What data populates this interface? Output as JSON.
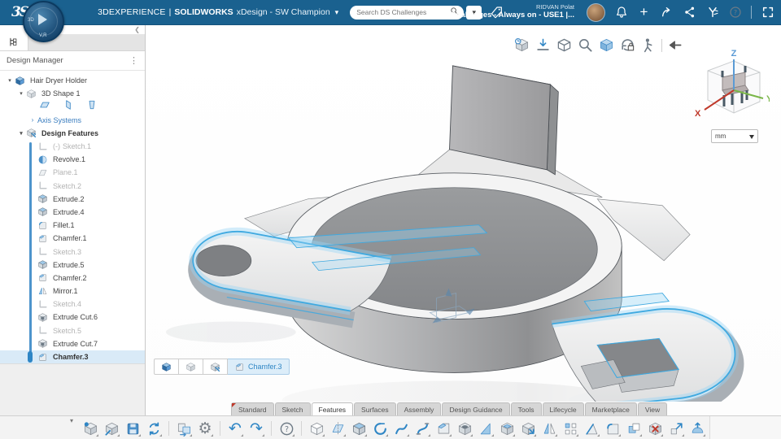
{
  "colors": {
    "topbar_bg": "#1a618f",
    "accent_blue": "#2f86c5",
    "highlight_blue": "#3fa9e0",
    "selection_bg": "#d9eaf7",
    "link_blue": "#3a7dbf",
    "muted_text": "#b3b3b3"
  },
  "topbar": {
    "logo": "3S",
    "compass": {
      "left_label": "3D",
      "bottom_label": "V,R"
    },
    "brand": "3DEXPERIENCE",
    "divider": "|",
    "product": "SOLIDWORKS",
    "context": "xDesign - SW Champion",
    "search": {
      "placeholder": "Search DS Challenges"
    },
    "user_name": "RIDVAN Polat",
    "workspace_title": "DS Challenges - Always on - USE1 |...",
    "right_icons": [
      {
        "name": "notifications-bell-icon"
      },
      {
        "name": "add-icon"
      },
      {
        "name": "share-icon"
      },
      {
        "name": "collaborate-icon"
      },
      {
        "name": "3dswym-icon"
      },
      {
        "name": "help-icon"
      },
      {
        "name": "separator"
      },
      {
        "name": "fullscreen-icon"
      }
    ]
  },
  "sidebar": {
    "panel_title": "Design Manager",
    "tree": [
      {
        "label": "Hair Dryer Holder",
        "icon": "product",
        "level": 0,
        "expander": "open"
      },
      {
        "label": "3D Shape 1",
        "icon": "shape3d",
        "level": 1,
        "expander": "open"
      },
      {
        "type": "planes",
        "level": 2,
        "planes": [
          "plane-xy-icon",
          "plane-yz-icon",
          "plane-zx-icon"
        ]
      },
      {
        "label": "Axis Systems",
        "level": 2,
        "expander": "closed",
        "link": true
      },
      {
        "label": "Design Features",
        "icon": "features",
        "level": 1,
        "expander": "open",
        "bold": true
      },
      {
        "label": "Sketch.1",
        "icon": "sketch",
        "level": 2,
        "muted": true,
        "prefix": "(-)",
        "guided": true
      },
      {
        "label": "Revolve.1",
        "icon": "revolve",
        "level": 2,
        "guided": true
      },
      {
        "label": "Plane.1",
        "icon": "plane",
        "level": 2,
        "muted": true,
        "guided": true
      },
      {
        "label": "Sketch.2",
        "icon": "sketch",
        "level": 2,
        "muted": true,
        "guided": true
      },
      {
        "label": "Extrude.2",
        "icon": "extrude",
        "level": 2,
        "guided": true
      },
      {
        "label": "Extrude.4",
        "icon": "extrude",
        "level": 2,
        "guided": true
      },
      {
        "label": "Fillet.1",
        "icon": "fillet",
        "level": 2,
        "guided": true
      },
      {
        "label": "Chamfer.1",
        "icon": "chamfer",
        "level": 2,
        "guided": true
      },
      {
        "label": "Sketch.3",
        "icon": "sketch",
        "level": 2,
        "muted": true,
        "guided": true
      },
      {
        "label": "Extrude.5",
        "icon": "extrude",
        "level": 2,
        "guided": true
      },
      {
        "label": "Chamfer.2",
        "icon": "chamfer",
        "level": 2,
        "guided": true
      },
      {
        "label": "Mirror.1",
        "icon": "mirror",
        "level": 2,
        "guided": true
      },
      {
        "label": "Sketch.4",
        "icon": "sketch",
        "level": 2,
        "muted": true,
        "guided": true
      },
      {
        "label": "Extrude Cut.6",
        "icon": "extrudecut",
        "level": 2,
        "guided": true
      },
      {
        "label": "Sketch.5",
        "icon": "sketch",
        "level": 2,
        "muted": true,
        "guided": true
      },
      {
        "label": "Extrude Cut.7",
        "icon": "extrudecut",
        "level": 2,
        "guided": true
      },
      {
        "label": "Chamfer.3",
        "icon": "chamfer",
        "level": 2,
        "selected": true,
        "bold": true,
        "guided": true
      }
    ]
  },
  "viewport": {
    "toolbar_icons": [
      {
        "name": "update-view-icon"
      },
      {
        "name": "normal-to-icon"
      },
      {
        "name": "display-style-icon"
      },
      {
        "name": "zoom-icon"
      },
      {
        "name": "shaded-view-icon"
      },
      {
        "name": "rotation-lock-icon"
      },
      {
        "name": "ergonomics-icon"
      },
      {
        "name": "separator"
      },
      {
        "name": "pin-icon"
      }
    ],
    "view_cube": {
      "x_label": "X",
      "y_label": "Y",
      "z_label": "Z"
    },
    "units": "mm",
    "breadcrumb": [
      {
        "icon": "product",
        "label": ""
      },
      {
        "icon": "shape3d",
        "label": ""
      },
      {
        "icon": "features",
        "label": ""
      },
      {
        "icon": "chamfer",
        "label": "Chamfer.3",
        "active": true
      }
    ]
  },
  "tabs": [
    {
      "label": "Standard"
    },
    {
      "label": "Sketch"
    },
    {
      "label": "Features",
      "active": true
    },
    {
      "label": "Surfaces"
    },
    {
      "label": "Assembly"
    },
    {
      "label": "Design Guidance"
    },
    {
      "label": "Tools"
    },
    {
      "label": "Lifecycle"
    },
    {
      "label": "Marketplace"
    },
    {
      "label": "View"
    }
  ],
  "bottom_toolbar": {
    "icons": [
      {
        "name": "new-part-icon"
      },
      {
        "name": "open-icon"
      },
      {
        "name": "save-icon"
      },
      {
        "name": "sync-icon"
      },
      {
        "name": "separator"
      },
      {
        "name": "import-export-icon"
      },
      {
        "name": "settings-icon"
      },
      {
        "name": "separator"
      },
      {
        "name": "undo-icon"
      },
      {
        "name": "redo-icon"
      },
      {
        "name": "separator"
      },
      {
        "name": "help-icon"
      },
      {
        "name": "separator"
      },
      {
        "name": "primitive-box-icon"
      },
      {
        "name": "split-icon"
      },
      {
        "name": "extrude-icon"
      },
      {
        "name": "revolve-icon"
      },
      {
        "name": "sweep-icon"
      },
      {
        "name": "loft-icon"
      },
      {
        "name": "chamfer-icon"
      },
      {
        "name": "hole-icon"
      },
      {
        "name": "rib-icon"
      },
      {
        "name": "shell-icon"
      },
      {
        "name": "move-face-icon"
      },
      {
        "name": "mirror-icon"
      },
      {
        "name": "pattern-icon"
      },
      {
        "name": "draft-icon"
      },
      {
        "name": "fillet-icon"
      },
      {
        "name": "combine-icon"
      },
      {
        "name": "delete-face-icon"
      },
      {
        "name": "scale-icon"
      },
      {
        "name": "dome-icon"
      },
      {
        "name": "bracket-icon"
      }
    ]
  }
}
